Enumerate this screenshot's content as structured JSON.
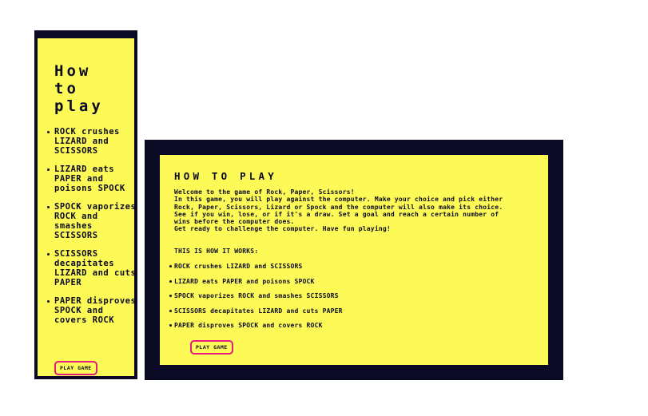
{
  "narrow_card": {
    "title": "How to play",
    "rules": [
      "ROCK crushes LIZARD and SCISSORS",
      "LIZARD eats PAPER and poisons SPOCK",
      "SPOCK vaporizes ROCK and smashes SCISSORS",
      "SCISSORS decapitates LIZARD and cuts PAPER",
      "PAPER disproves SPOCK and covers ROCK"
    ],
    "play_button": "PLAY GAME"
  },
  "wide_card": {
    "title": "HOW TO PLAY",
    "intro_lines": [
      "Welcome to the game of Rock, Paper, Scissors!",
      "In this game, you will play against the computer. Make your choice and pick either Rock, Paper, Scissors, Lizard or Spock and the computer will also make its choice.",
      "See if you win, lose, or if it's a draw. Set a goal and reach a certain number of wins before the computer does.",
      "Get ready to challenge the computer. Have fun playing!"
    ],
    "works_heading": "THIS IS HOW IT WORKS:",
    "rules": [
      "ROCK crushes LIZARD and SCISSORS",
      "LIZARD eats PAPER and poisons SPOCK",
      "SPOCK vaporizes ROCK and smashes SCISSORS",
      "SCISSORS decapitates LIZARD and cuts PAPER",
      "PAPER disproves SPOCK and covers ROCK"
    ],
    "play_button": "PLAY GAME"
  },
  "colors": {
    "card_background": "#fdf957",
    "frame": "#0a0a24",
    "button_border": "#e6197f",
    "text": "#0b0b22"
  }
}
